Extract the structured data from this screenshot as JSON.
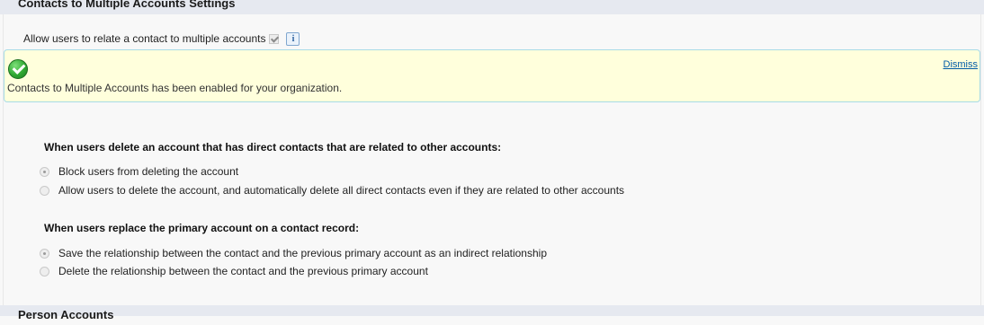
{
  "section_title": "Contacts to Multiple Accounts Settings",
  "next_section_title": "Person Accounts",
  "allow_setting": {
    "label": "Allow users to relate a contact to multiple accounts",
    "checked": true,
    "info_icon": "info-icon",
    "info_glyph": "i"
  },
  "banner": {
    "icon": "success-check-icon",
    "message": "Contacts to Multiple Accounts has been enabled for your organization.",
    "dismiss_label": "Dismiss"
  },
  "delete_account_setting": {
    "question": "When users delete an account that has direct contacts that are related to other accounts:",
    "options": [
      {
        "label": "Block users from deleting the account",
        "selected": true
      },
      {
        "label": "Allow users to delete the account, and automatically delete all direct contacts even if they are related to other accounts",
        "selected": false
      }
    ]
  },
  "replace_primary_setting": {
    "question": "When users replace the primary account on a contact record:",
    "options": [
      {
        "label": "Save the relationship between the contact and the previous primary account as an indirect relationship",
        "selected": true
      },
      {
        "label": "Delete the relationship between the contact and the previous primary account",
        "selected": false
      }
    ]
  },
  "colors": {
    "header_bg": "#e6e9f0",
    "banner_bg": "#ffffdc",
    "banner_border": "#a7dbe6",
    "link": "#015ba7",
    "success_green": "#2fa832"
  }
}
